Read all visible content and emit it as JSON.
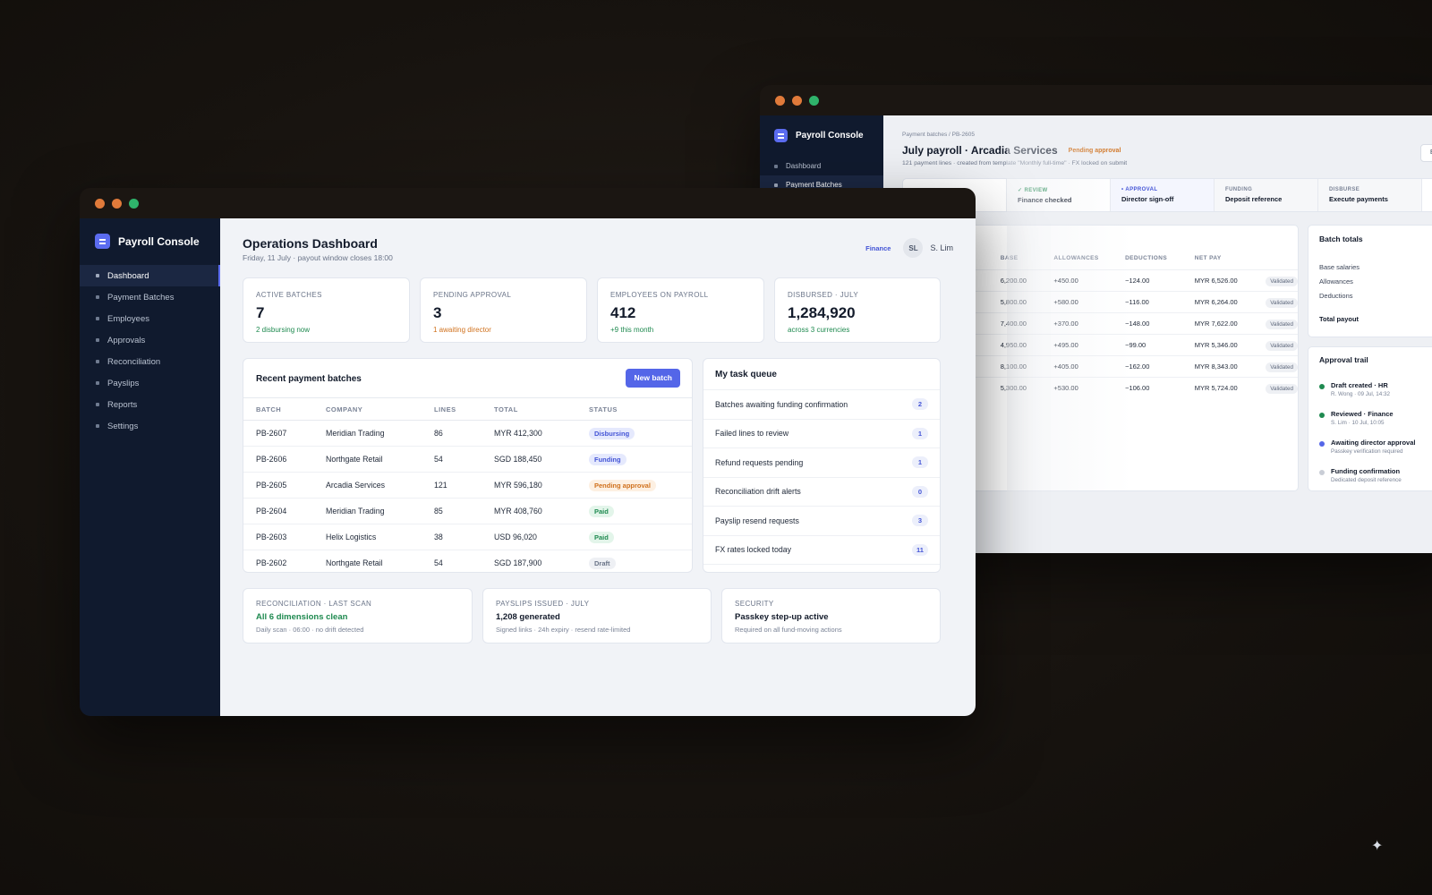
{
  "app_name": "Payroll Console",
  "colors": {
    "accent": "#5466e8",
    "success": "#1f8a50",
    "warning": "#d0711d",
    "sidebar": "#101a2e"
  },
  "front": {
    "nav": [
      "Dashboard",
      "Payment Batches",
      "Employees",
      "Approvals",
      "Reconciliation",
      "Payslips",
      "Reports",
      "Settings"
    ],
    "title": "Operations Dashboard",
    "subtitle": "Friday, 11 July · payout window closes 18:00",
    "role": "Finance",
    "avatar_initials": "SL",
    "user_name": "S. Lim",
    "kpis": [
      {
        "label": "ACTIVE BATCHES",
        "value": "7",
        "note": "2 disbursing now"
      },
      {
        "label": "PENDING APPROVAL",
        "value": "3",
        "note": "1 awaiting director"
      },
      {
        "label": "EMPLOYEES ON PAYROLL",
        "value": "412",
        "note": "+9 this month"
      },
      {
        "label": "DISBURSED · JULY",
        "value": "1,284,920",
        "note": "across 3 currencies"
      }
    ],
    "batches": {
      "title": "Recent payment batches",
      "new_button": "New batch",
      "columns": [
        "BATCH",
        "COMPANY",
        "LINES",
        "TOTAL",
        "STATUS"
      ],
      "rows": [
        [
          "PB-2607",
          "Meridian Trading",
          "86",
          "MYR 412,300",
          "Disbursing"
        ],
        [
          "PB-2606",
          "Northgate Retail",
          "54",
          "SGD 188,450",
          "Funding"
        ],
        [
          "PB-2605",
          "Arcadia Services",
          "121",
          "MYR 596,180",
          "Pending approval"
        ],
        [
          "PB-2604",
          "Meridian Trading",
          "85",
          "MYR 408,760",
          "Paid"
        ],
        [
          "PB-2603",
          "Helix Logistics",
          "38",
          "USD 96,020",
          "Paid"
        ],
        [
          "PB-2602",
          "Northgate Retail",
          "54",
          "SGD 187,900",
          "Draft"
        ]
      ]
    },
    "tasks": {
      "title": "My task queue",
      "items": [
        {
          "label": "Batches awaiting funding confirmation",
          "count": "2"
        },
        {
          "label": "Failed lines to review",
          "count": "1"
        },
        {
          "label": "Refund requests pending",
          "count": "1"
        },
        {
          "label": "Reconciliation drift alerts",
          "count": "0"
        },
        {
          "label": "Payslip resend requests",
          "count": "3"
        },
        {
          "label": "FX rates locked today",
          "count": "11"
        }
      ]
    },
    "mini": [
      {
        "label": "RECONCILIATION · LAST SCAN",
        "head": "All 6 dimensions clean",
        "sub": "Daily scan · 06:00 · no drift detected"
      },
      {
        "label": "PAYSLIPS ISSUED · JULY",
        "head": "1,208 generated",
        "sub": "Signed links · 24h expiry · resend rate-limited"
      },
      {
        "label": "SECURITY",
        "head": "Passkey step-up active",
        "sub": "Required on all fund-moving actions"
      }
    ]
  },
  "back": {
    "nav": [
      "Dashboard",
      "Payment Batches"
    ],
    "breadcrumb": "Payment batches / PB-2605",
    "title": "July payroll · Arcadia Services",
    "status": "Pending approval",
    "subtitle": "121 payment lines · created from template \"Monthly full-time\" · FX locked on submit",
    "button_partial": "E",
    "steps": [
      {
        "key": "✓ REVIEW",
        "value": "Finance checked"
      },
      {
        "key": "• APPROVAL",
        "value": "Director sign-off"
      },
      {
        "key": "FUNDING",
        "value": "Deposit reference"
      },
      {
        "key": "DISBURSE",
        "value": "Execute payments"
      }
    ],
    "lines": {
      "columns": [
        "BASE",
        "ALLOWANCES",
        "DEDUCTIONS",
        "NET PAY"
      ],
      "rows": [
        [
          "6,200.00",
          "+450.00",
          "−124.00",
          "MYR 6,526.00",
          "Validated"
        ],
        [
          "5,800.00",
          "+580.00",
          "−116.00",
          "MYR 6,264.00",
          "Validated"
        ],
        [
          "7,400.00",
          "+370.00",
          "−148.00",
          "MYR 7,622.00",
          "Validated"
        ],
        [
          "4,950.00",
          "+495.00",
          "−99.00",
          "MYR 5,346.00",
          "Validated"
        ],
        [
          "8,100.00",
          "+405.00",
          "−162.00",
          "MYR 8,343.00",
          "Validated"
        ],
        [
          "5,300.00",
          "+530.00",
          "−106.00",
          "MYR 5,724.00",
          "Validated"
        ]
      ]
    },
    "totals": {
      "title": "Batch totals",
      "rows": [
        "Base salaries",
        "Allowances",
        "Deductions",
        "Total payout"
      ]
    },
    "trail": {
      "title": "Approval trail",
      "events": [
        {
          "title": "Draft created · HR",
          "sub": "R. Wong · 09 Jul, 14:32",
          "color": "#1f8a50"
        },
        {
          "title": "Reviewed · Finance",
          "sub": "S. Lim · 10 Jul, 10:05",
          "color": "#1f8a50"
        },
        {
          "title": "Awaiting director approval",
          "sub": "Passkey verification required",
          "color": "#5466e8"
        },
        {
          "title": "Funding confirmation",
          "sub": "Dedicated deposit reference",
          "color": "#c9cdd6"
        }
      ]
    }
  }
}
